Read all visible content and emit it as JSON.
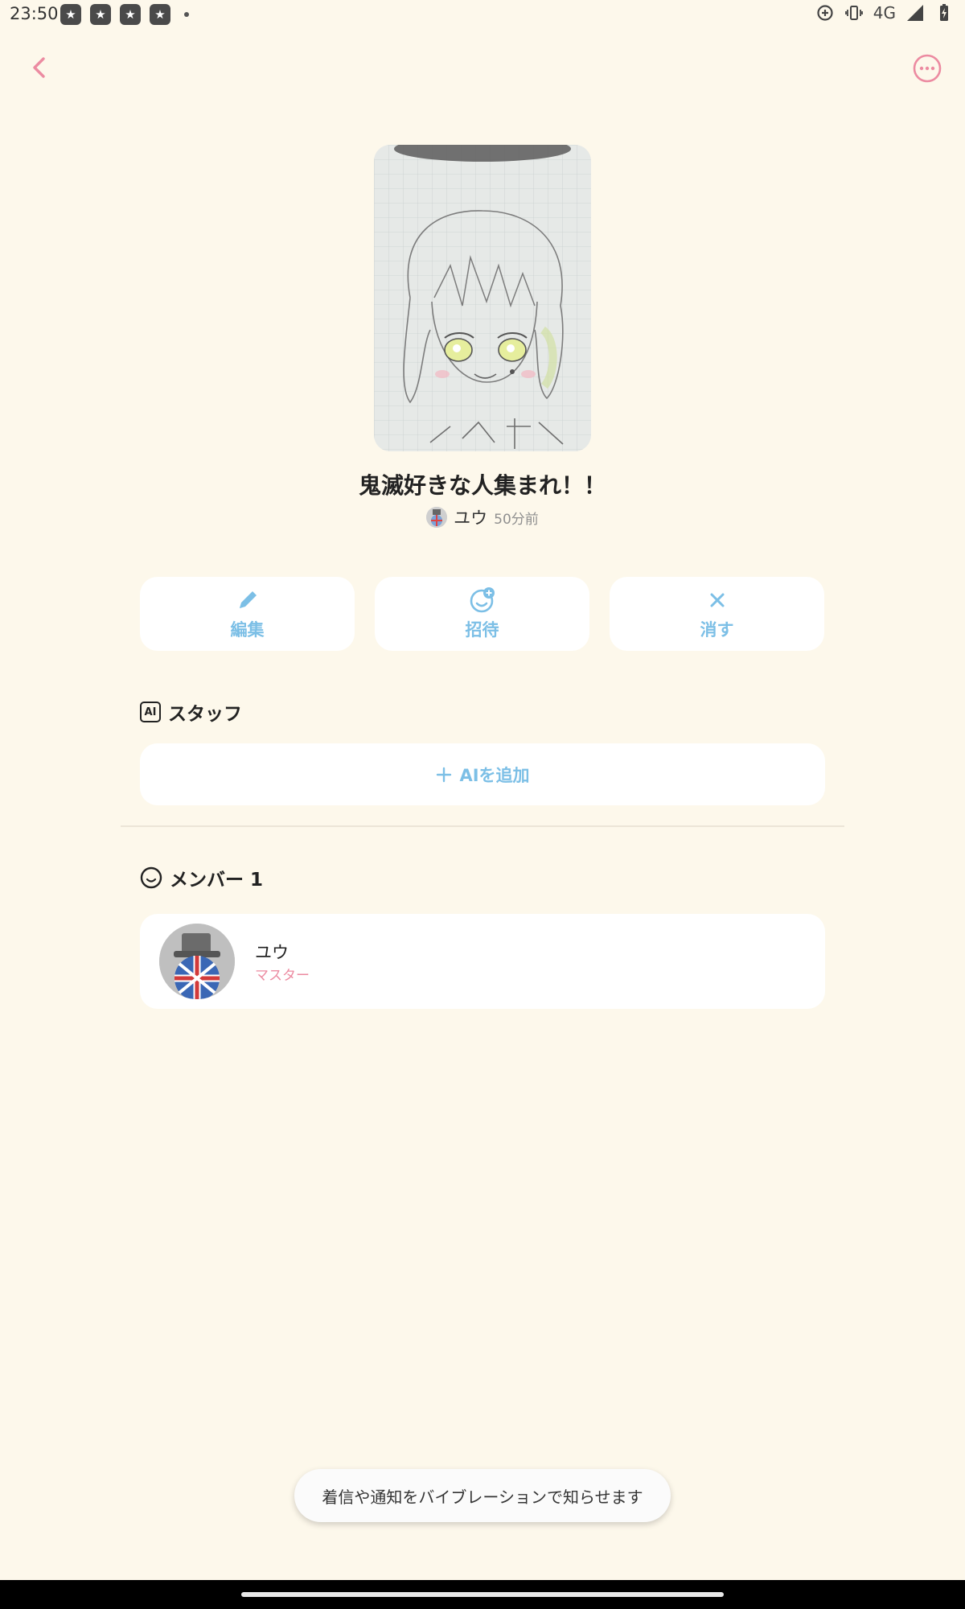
{
  "status_bar": {
    "time": "23:50",
    "notification_icons": [
      "app-notification-icon",
      "app-notification-icon",
      "app-notification-icon",
      "app-notification-icon"
    ],
    "network": "4G"
  },
  "header": {
    "back_icon": "chevron-left-icon",
    "more_icon": "more-horizontal-icon"
  },
  "group": {
    "title": "鬼滅好きな人集まれ！！",
    "owner_name": "ユウ",
    "time_ago": "50分前"
  },
  "actions": {
    "edit_label": "編集",
    "invite_label": "招待",
    "delete_label": "消す"
  },
  "staff": {
    "badge": "AI",
    "heading": "スタッフ",
    "add_label": "AIを追加"
  },
  "members": {
    "heading": "メンバー 1",
    "list": [
      {
        "name": "ユウ",
        "role": "マスター"
      }
    ]
  },
  "toast": {
    "message": "着信や通知をバイブレーションで知らせます"
  },
  "colors": {
    "background": "#fdf8eb",
    "accent_blue": "#7cbfe6",
    "accent_pink": "#ec8ba1"
  }
}
